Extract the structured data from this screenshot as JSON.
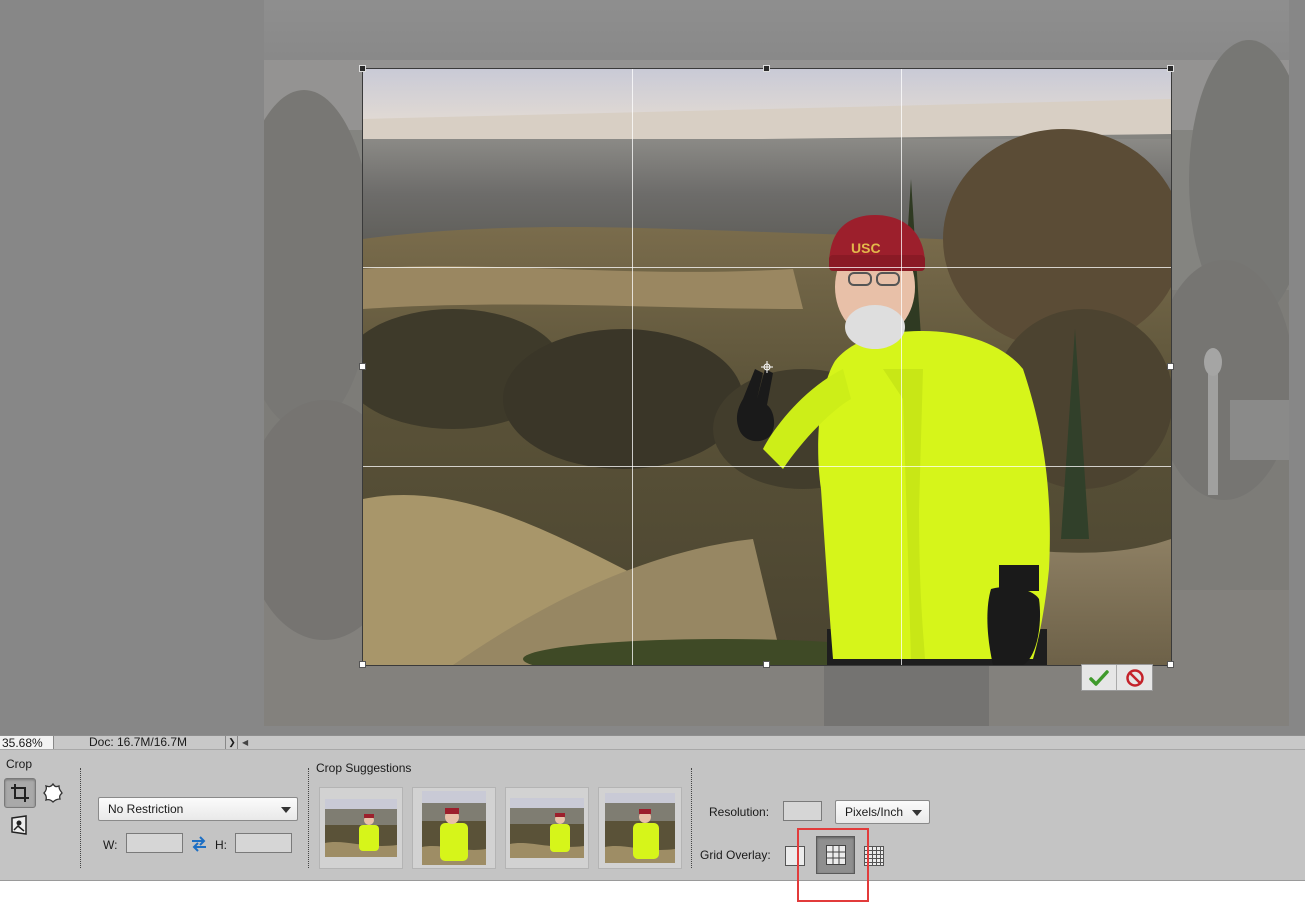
{
  "status_bar": {
    "zoom": "35.68%",
    "doc_size": "Doc: 16.7M/16.7M",
    "arrow_glyph": "❯",
    "scroll_left_glyph": "◀"
  },
  "crop_box": {
    "commit_icon": "checkmark-icon",
    "cancel_icon": "cancel-icon"
  },
  "tool_options": {
    "title": "Crop",
    "tools": [
      {
        "name": "crop-tool",
        "icon": "crop-icon",
        "selected": true
      },
      {
        "name": "cookie-cutter-tool",
        "icon": "cookie-cutter-icon",
        "selected": false
      },
      {
        "name": "perspective-crop-tool",
        "icon": "perspective-crop-icon",
        "selected": false
      }
    ],
    "aspect_ratio": {
      "value": "No Restriction"
    },
    "width": {
      "label": "W:",
      "value": ""
    },
    "height": {
      "label": "H:",
      "value": ""
    },
    "swap_icon": "swap-arrows-icon",
    "suggestions": {
      "title": "Crop Suggestions",
      "count": 4
    },
    "resolution": {
      "label": "Resolution:",
      "value": "",
      "units": "Pixels/Inch"
    },
    "grid_overlay": {
      "label": "Grid Overlay:",
      "options": [
        "none",
        "rule-of-thirds",
        "grid"
      ],
      "selected": "rule-of-thirds"
    }
  },
  "colors": {
    "highlight": "#e23b3b",
    "jacket": "#d6f51a",
    "hat": "#9c1f2c",
    "commit_check": "#3f9a2b",
    "cancel_red": "#c4222a"
  }
}
